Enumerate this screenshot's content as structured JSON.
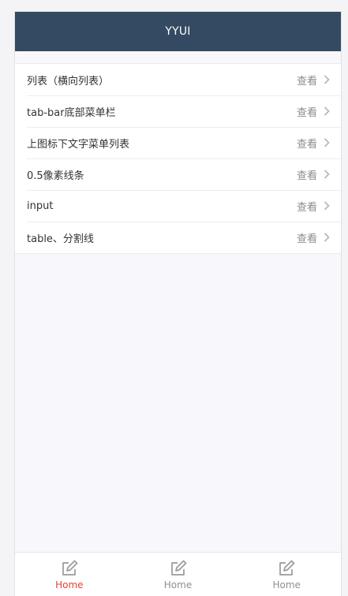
{
  "header": {
    "title": "YYUI"
  },
  "list": {
    "items": [
      {
        "title": "列表（横向列表）",
        "action": "查看"
      },
      {
        "title": "tab-bar底部菜单栏",
        "action": "查看"
      },
      {
        "title": "上图标下文字菜单列表",
        "action": "查看"
      },
      {
        "title": "0.5像素线条",
        "action": "查看"
      },
      {
        "title": "input",
        "action": "查看"
      },
      {
        "title": "table、分割线",
        "action": "查看"
      }
    ]
  },
  "tabbar": {
    "tabs": [
      {
        "label": "Home",
        "icon": "edit-icon",
        "active": true
      },
      {
        "label": "Home",
        "icon": "edit-icon",
        "active": false
      },
      {
        "label": "Home",
        "icon": "edit-icon",
        "active": false
      }
    ]
  },
  "colors": {
    "header_bg": "#344a62",
    "active_tab": "#e0443c",
    "page_bg": "#f8f8fc"
  }
}
